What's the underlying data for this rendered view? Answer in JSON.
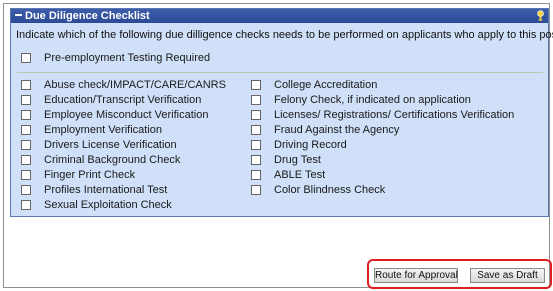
{
  "panel": {
    "title": "Due Diligence Checklist",
    "collapse_icon": "minus-icon",
    "help_icon": "help-icon",
    "instructions": "Indicate which of the following due dilligence checks needs to be performed on applicants who apply to this position."
  },
  "pre_employment": {
    "label": "Pre-employment Testing Required",
    "checked": false
  },
  "left_checks": [
    {
      "label": "Abuse check/IMPACT/CARE/CANRS",
      "checked": false
    },
    {
      "label": "Education/Transcript Verification",
      "checked": false
    },
    {
      "label": "Employee Misconduct Verification",
      "checked": false
    },
    {
      "label": "Employment Verification",
      "checked": false
    },
    {
      "label": "Drivers License Verification",
      "checked": false
    },
    {
      "label": "Criminal Background Check",
      "checked": false
    },
    {
      "label": "Finger Print Check",
      "checked": false
    },
    {
      "label": "Profiles International Test",
      "checked": false
    },
    {
      "label": "Sexual Exploitation Check",
      "checked": false
    }
  ],
  "right_checks": [
    {
      "label": "College Accreditation",
      "checked": false
    },
    {
      "label": "Felony Check, if indicated on application",
      "checked": false
    },
    {
      "label": "Licenses/ Registrations/ Certifications Verification",
      "checked": false
    },
    {
      "label": "Fraud Against the Agency",
      "checked": false
    },
    {
      "label": "Driving Record",
      "checked": false
    },
    {
      "label": "Drug Test",
      "checked": false
    },
    {
      "label": "ABLE Test",
      "checked": false
    },
    {
      "label": "Color Blindness Check",
      "checked": false
    }
  ],
  "buttons": {
    "route": "Route for Approval",
    "draft": "Save as Draft"
  },
  "colors": {
    "header": "#2c4a96",
    "panel_bg": "#cfe0f8",
    "highlight": "#e02020"
  }
}
